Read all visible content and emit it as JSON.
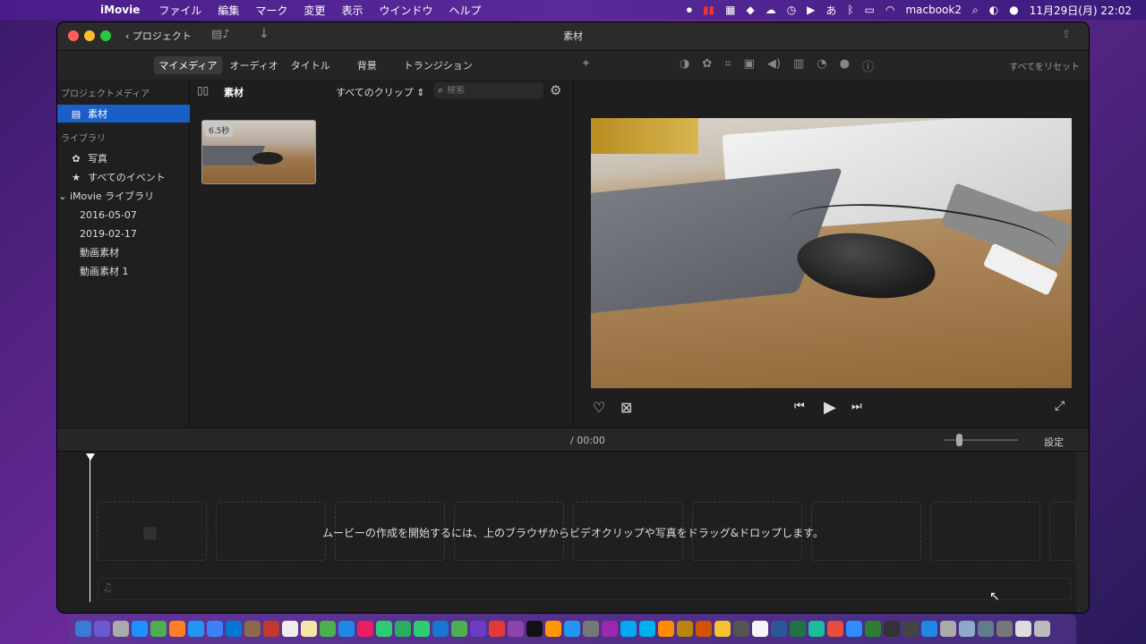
{
  "menubar": {
    "app_name": "iMovie",
    "items": [
      "ファイル",
      "編集",
      "マーク",
      "変更",
      "表示",
      "ウインドウ",
      "ヘルプ"
    ],
    "computer_name": "macbook2",
    "datetime": "11月29日(月)  22:02",
    "input_method": "あ"
  },
  "window": {
    "title": "素材",
    "back_label": "プロジェクト"
  },
  "browser_tabs": [
    "マイメディア",
    "オーディオ",
    "タイトル",
    "背景",
    "トランジション"
  ],
  "adjust": {
    "reset_label": "すべてをリセット"
  },
  "sidebar": {
    "project_media_header": "プロジェクトメディア",
    "project_item": "素材",
    "library_header": "ライブラリ",
    "photos": "写真",
    "all_events": "すべてのイベント",
    "imovie_library": "iMovie ライブラリ",
    "events": [
      "2016-05-07",
      "2019-02-17",
      "動画素材",
      "動画素材 1"
    ]
  },
  "library": {
    "title": "素材",
    "clip_filter": "すべてのクリップ",
    "search_placeholder": "検索",
    "clips": [
      {
        "duration": "6.5秒"
      }
    ]
  },
  "timeline": {
    "timecode": "/  00:00",
    "settings_label": "設定",
    "hint": "ムービーの作成を開始するには、上のブラウザからビデオクリップや写真をドラッグ&ドロップします。"
  },
  "colors": {
    "selection": "#1a5fc8",
    "window_bg": "#1e1e1e"
  }
}
